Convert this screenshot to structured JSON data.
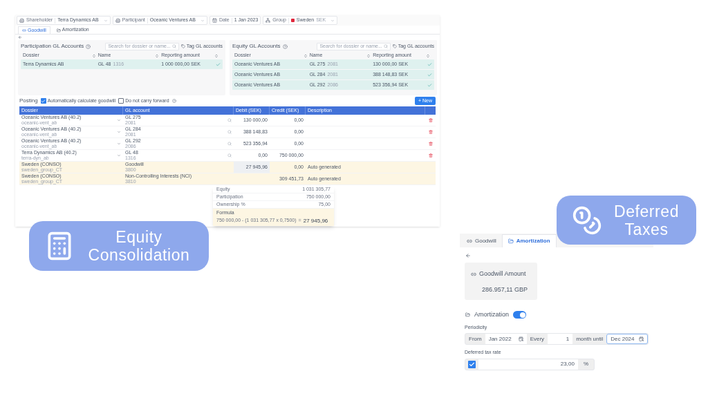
{
  "equity_screen": {
    "filters": [
      {
        "kind": "select",
        "label": "Shareholder",
        "value": "Terra Dynamics AB"
      },
      {
        "kind": "select",
        "label": "Participant",
        "value": "Oceanic Ventures AB"
      },
      {
        "kind": "date",
        "label": "Date",
        "value": "1 Jan 2023"
      },
      {
        "kind": "group",
        "label": "Group",
        "value": "Sweden",
        "sub": "SEK",
        "color": "#e0263b"
      }
    ],
    "tabs": [
      {
        "label": "Goodwill",
        "selected": true
      },
      {
        "label": "Amortization",
        "selected": false
      }
    ],
    "panels": [
      {
        "title": "Participation GL Accounts",
        "search_placeholder": "Search for dossier or name...",
        "tag_button": "Tag GL accounts",
        "columns": [
          "Dossier",
          "Name",
          "Reporting amount"
        ],
        "rows": [
          {
            "dossier": "Terra Dynamics AB",
            "name": "GL 48",
            "code": "1316",
            "amount": "1 000 000,00 SEK",
            "checked": true
          }
        ]
      },
      {
        "title": "Equity GL Accounts",
        "search_placeholder": "Search for dossier or name...",
        "tag_button": "Tag GL accounts",
        "columns": [
          "Dossier",
          "Name",
          "Reporting amount"
        ],
        "rows": [
          {
            "dossier": "Oceanic Ventures AB",
            "name": "GL 275",
            "code": "2081",
            "amount": "130 000,00 SEK",
            "checked": true
          },
          {
            "dossier": "Oceanic Ventures AB",
            "name": "GL 284",
            "code": "2081",
            "amount": "388 148,83 SEK",
            "checked": true
          },
          {
            "dossier": "Oceanic Ventures AB",
            "name": "GL 292",
            "code": "2086",
            "amount": "523 356,94 SEK",
            "checked": true
          }
        ]
      }
    ],
    "posting": {
      "title": "Posting",
      "options": [
        {
          "label": "Automatically calculate goodwill",
          "checked": true
        },
        {
          "label": "Do not carry forward",
          "checked": false
        }
      ],
      "new_button": "+ New",
      "columns": [
        "Dossier",
        "GL account",
        "Debit (SEK)",
        "Credit (SEK)",
        "Description"
      ],
      "rows": [
        {
          "kind": "manual",
          "dossier": "Oceanic Ventures AB (40.2)",
          "dossier_sub": "oceanic-vent_ab",
          "account": "GL 275",
          "account_sub": "2081",
          "debit": "130 000,00",
          "credit": "0,00",
          "description": ""
        },
        {
          "kind": "manual",
          "dossier": "Oceanic Ventures AB (40.2)",
          "dossier_sub": "oceanic-vent_ab",
          "account": "GL 284",
          "account_sub": "2081",
          "debit": "388 148,83",
          "credit": "0,00",
          "description": ""
        },
        {
          "kind": "manual",
          "dossier": "Oceanic Ventures AB (40.2)",
          "dossier_sub": "oceanic-vent_ab",
          "account": "GL 292",
          "account_sub": "2086",
          "debit": "523 356,94",
          "credit": "0,00",
          "description": ""
        },
        {
          "kind": "manual",
          "dossier": "Terra Dynamics AB (40.2)",
          "dossier_sub": "terra-dyn_ab",
          "account": "GL 48",
          "account_sub": "1316",
          "debit": "0,00",
          "credit": "750 000,00",
          "description": ""
        },
        {
          "kind": "auto",
          "dossier": "Sweden (CONSO)",
          "dossier_sub": "sweden_group_CT",
          "account": "Goodwill",
          "account_sub": "3800",
          "debit": "27 945,96",
          "credit": "0,00",
          "description": "Auto generated"
        },
        {
          "kind": "auto",
          "dossier": "Sweden (CONSO)",
          "dossier_sub": "sweden_group_CT",
          "account": "Non-Controlling Interests (NCI)",
          "account_sub": "3810",
          "credit": "309 451,73",
          "description": "Auto generated"
        }
      ],
      "popover": {
        "lines": [
          {
            "label": "Equity",
            "value": "1 031 305,77"
          },
          {
            "label": "Participation",
            "value": "750 000,00"
          },
          {
            "label": "Ownership %",
            "value": "75,00"
          }
        ],
        "formula_label": "Formula",
        "formula": "750 000,00 - (1 031 305,77 x 0,7500)",
        "equals": "=",
        "result": "27 945,96"
      }
    }
  },
  "equity_badge": {
    "text": "Equity Consolidation"
  },
  "deferred_badge": {
    "text": "Deferred Taxes"
  },
  "amortization_screen": {
    "tabs": [
      {
        "label": "Goodwill",
        "selected": false
      },
      {
        "label": "Amortization",
        "selected": true
      }
    ],
    "goodwill_card": {
      "title": "Goodwill Amount",
      "amount": "286.957,11 GBP"
    },
    "amortization": {
      "label": "Amortization",
      "on": true
    },
    "periodicity": {
      "label": "Periodicity",
      "from_label": "From",
      "from": "Jan 2022",
      "every_label": "Every",
      "every": "1",
      "until_label": "month until",
      "until": "Dec 2024"
    },
    "deferred_tax": {
      "label": "Deferred tax rate",
      "checked": true,
      "rate": "23,00",
      "unit": "%"
    }
  }
}
